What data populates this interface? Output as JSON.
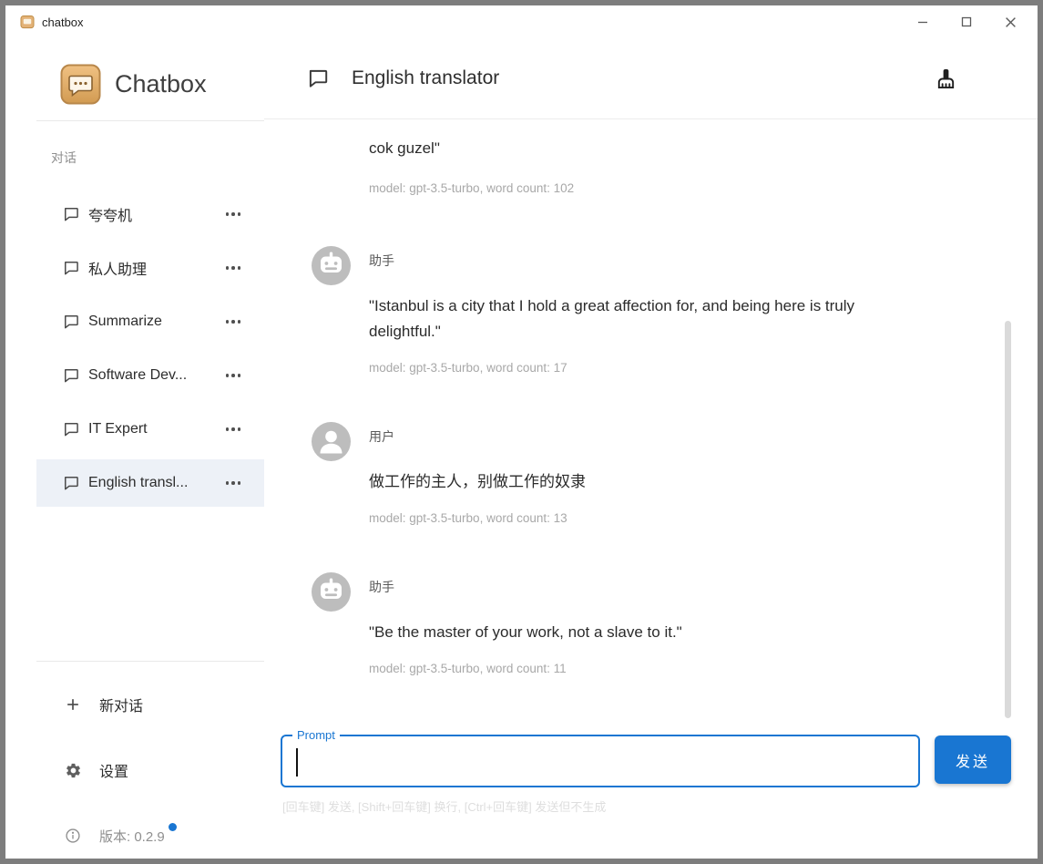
{
  "titlebar": {
    "title": "chatbox"
  },
  "sidebar": {
    "brand": "Chatbox",
    "section_label": "对话",
    "chats": [
      {
        "label": "夸夸机",
        "selected": false
      },
      {
        "label": "私人助理",
        "selected": false
      },
      {
        "label": "Summarize",
        "selected": false
      },
      {
        "label": "Software Dev...",
        "selected": false
      },
      {
        "label": "IT Expert",
        "selected": false
      },
      {
        "label": "English transl...",
        "selected": true
      }
    ],
    "new_chat_label": "新对话",
    "settings_label": "设置",
    "version_label": "版本: 0.2.9"
  },
  "main": {
    "header": {
      "title": "English translator"
    },
    "messages": [
      {
        "role": "assistant-partial",
        "text": "cok guzel\"",
        "meta": "model: gpt-3.5-turbo, word count: 102"
      },
      {
        "role": "assistant",
        "name": "助手",
        "text": "\"Istanbul is a city that I hold a great affection for, and being here is truly delightful.\"",
        "meta": "model: gpt-3.5-turbo, word count: 17"
      },
      {
        "role": "user",
        "name": "用户",
        "text": "做工作的主人，别做工作的奴隶",
        "meta": "model: gpt-3.5-turbo, word count: 13"
      },
      {
        "role": "assistant",
        "name": "助手",
        "text": "\"Be the master of your work, not a slave to it.\"",
        "meta": "model: gpt-3.5-turbo, word count: 11"
      }
    ],
    "prompt": {
      "label": "Prompt",
      "value": "",
      "send_label": "发送",
      "hint": "[回车键] 发送, [Shift+回车键] 换行, [Ctrl+回车键] 发送但不生成"
    }
  },
  "icons": {
    "app-logo": "orange speech-bubble app icon",
    "chat-bubble-icon": "speech bubble outline",
    "more-icon": "three horizontal dots",
    "plus-icon": "plus sign",
    "gear-icon": "settings gear",
    "info-icon": "circled i",
    "cleaning-brush-icon": "cleaning brush",
    "robot-avatar-icon": "robot face",
    "user-avatar-icon": "person silhouette",
    "minimize-icon": "minus",
    "maximize-icon": "square",
    "close-icon": "x"
  },
  "colors": {
    "accent": "#1976d2",
    "selected_item_bg": "#edf1f7",
    "avatar_bg": "#bdbdbd",
    "logo_orange": "#d79a4b",
    "meta_text": "#a8a8a8",
    "hint_text": "#dedede",
    "badge_dot": "#1976d2"
  }
}
